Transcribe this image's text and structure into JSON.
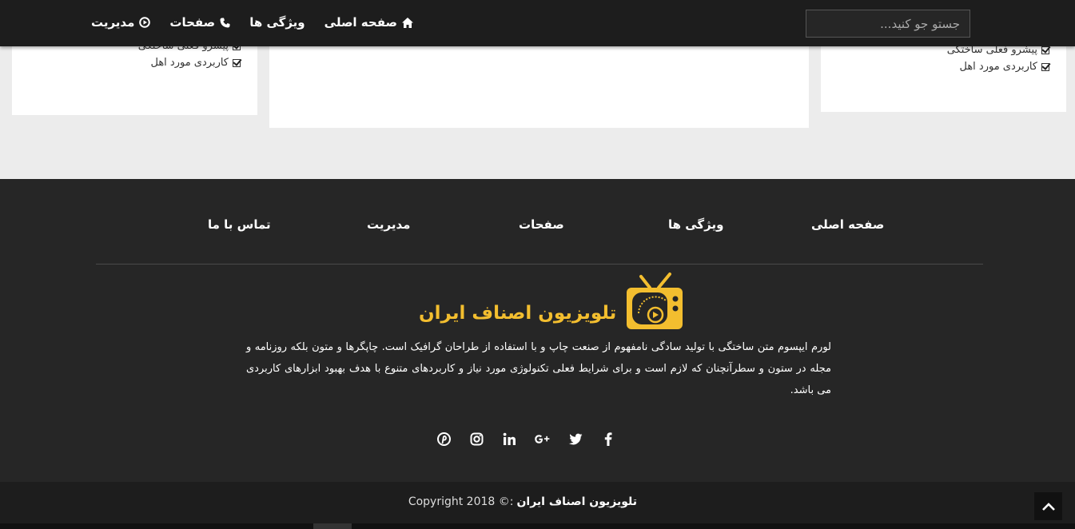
{
  "nav": {
    "items": [
      {
        "label": "صفحه اصلی",
        "icon": "home-icon"
      },
      {
        "label": "ویژگی ها",
        "icon": ""
      },
      {
        "label": "صفحات",
        "icon": "phone-icon"
      },
      {
        "label": "مدیریت",
        "icon": "play-circle-icon"
      }
    ],
    "search_placeholder": "جستو جو کنید..."
  },
  "cards": {
    "left_items": [
      "پیشرو فعلی ساختگی",
      "کاربردی مورد اهل"
    ],
    "right_items": [
      "پیشرو فعلی ساختگی",
      "کاربردی مورد اهل"
    ]
  },
  "footer": {
    "nav": [
      "صفحه اصلی",
      "ویژگی ها",
      "صفحات",
      "مدیریت",
      "تماس با ما"
    ],
    "brand_name": "تلویزیون اصناف ایران",
    "description": "لورم ایپسوم متن ساختگی با تولید سادگی نامفهوم از صنعت چاپ و با استفاده از طراحان گرافیک است. چاپگرها و متون بلکه روزنامه و مجله در ستون و سطرآنچنان که لازم است و برای شرایط فعلی تکنولوژی مورد نیاز و کاربردهای متنوع با هدف بهبود ابزارهای کاربردی می باشد.",
    "social": [
      "pinterest-icon",
      "instagram-icon",
      "linkedin-icon",
      "google-plus-icon",
      "twitter-icon",
      "facebook-icon"
    ],
    "copyright_brand": "تلویزیون اصناف ایران",
    "copyright_text": "Copyright 2018 ©:"
  },
  "colors": {
    "accent": "#f3be2f",
    "footer_bg": "#262626",
    "navbar_bg": "#1d1d1d"
  }
}
